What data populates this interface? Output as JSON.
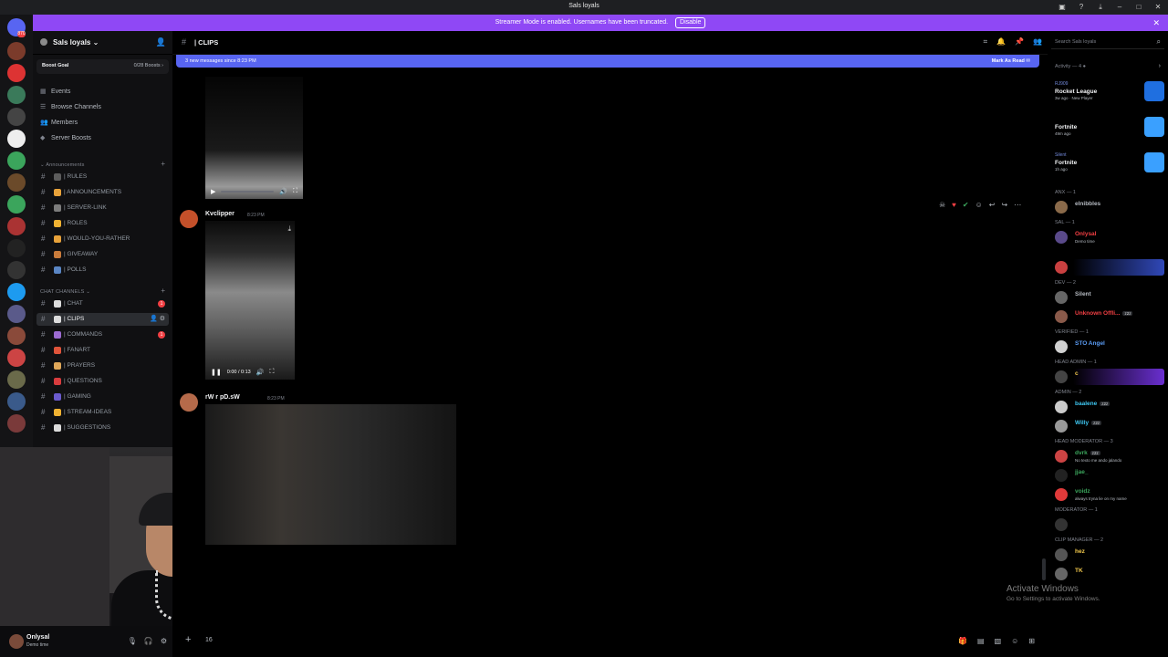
{
  "window": {
    "title": "Sals loyals"
  },
  "banner": {
    "text": "Streamer Mode is enabled. Usernames have been truncated.",
    "disable_label": "Disable"
  },
  "server": {
    "name": "Sals loyals",
    "boost_goal_label": "Boost Goal",
    "boost_count": "0/28 Boosts"
  },
  "nav": [
    {
      "label": "Events",
      "icon": "calendar-icon"
    },
    {
      "label": "Browse Channels",
      "icon": "browse-icon"
    },
    {
      "label": "Members",
      "icon": "members-icon"
    },
    {
      "label": "Server Boosts",
      "icon": "boost-icon"
    }
  ],
  "categories": {
    "announcements": "Announcements",
    "chat_channels": "CHAT CHANNELS"
  },
  "announcement_channels": [
    {
      "name": "| RULES",
      "emoji_color": "#5c5c5c"
    },
    {
      "name": "| ANNOUNCEMENTS",
      "emoji_color": "#e8a23a"
    },
    {
      "name": "| SERVER-LINK",
      "emoji_color": "#7c7c7c"
    },
    {
      "name": "| ROLES",
      "emoji_color": "#f0b232"
    },
    {
      "name": "| WOULD-YOU-RATHER",
      "emoji_color": "#e8a23a"
    },
    {
      "name": "| GIVEAWAY",
      "emoji_color": "#c97b3b"
    },
    {
      "name": "| POLLS",
      "emoji_color": "#5a86c5"
    }
  ],
  "chat_channels": [
    {
      "name": "| CHAT",
      "emoji_color": "#dcdcdc",
      "unread": "1"
    },
    {
      "name": "| CLIPS",
      "emoji_color": "#dcdcdc",
      "active": true
    },
    {
      "name": "| COMMANDS",
      "emoji_color": "#9c6bd1",
      "unread": "1"
    },
    {
      "name": "| FANART",
      "emoji_color": "#e0543a"
    },
    {
      "name": "| PRAYERS",
      "emoji_color": "#e0a85a"
    },
    {
      "name": "| QUESTIONS",
      "emoji_color": "#d83c3e"
    },
    {
      "name": "| GAMING",
      "emoji_color": "#6a5acd"
    },
    {
      "name": "| STREAM-IDEAS",
      "emoji_color": "#f0b232"
    },
    {
      "name": "| SUGGESTIONS",
      "emoji_color": "#dcdcdc"
    }
  ],
  "chat": {
    "channel_name": "| CLIPS",
    "new_messages": "3 new messages since 8:23 PM",
    "mark_as_read": "Mark As Read",
    "messages": [
      {
        "author": "Kvclipper",
        "time": "8:23 PM",
        "video_time": "0:00 / 0:13"
      },
      {
        "author": "rW r pD.sW",
        "time": "8:23 PM"
      }
    ]
  },
  "composer": {
    "count": "16"
  },
  "user": {
    "name": "Onlysal",
    "status": "Demo time"
  },
  "right": {
    "search_placeholder": "Search Sals loyals",
    "activity_label": "Activity — 4",
    "activities": [
      {
        "who": "RJ909",
        "game": "Rocket League",
        "when": "3w ago · New Player",
        "color": "#1f6fe0"
      },
      {
        "who": "",
        "game": "Fortnite",
        "when": "49m ago",
        "color": "#3aa0ff"
      },
      {
        "who": "Silent",
        "game": "Fortnite",
        "when": "1h ago",
        "color": "#3aa0ff"
      }
    ],
    "sections": [
      {
        "label": "ANX — 1",
        "members": [
          {
            "name": "elnibbles",
            "color": "#b5bac1",
            "status": "",
            "avatar": "#8a6a4a"
          }
        ]
      },
      {
        "label": "SAL — 1",
        "members": [
          {
            "name": "Onlysal",
            "color": "#f23f43",
            "status": "Demo time",
            "avatar": "#5a4a8a"
          }
        ]
      },
      {
        "label": "",
        "members": [
          {
            "name": "",
            "color": "#f23f43",
            "status": "",
            "avatar": "#c94040",
            "glow": "#3048b8"
          }
        ]
      },
      {
        "label": "DEV — 2",
        "members": [
          {
            "name": "Silent",
            "color": "#b5bac1",
            "status": "",
            "avatar": "#666"
          },
          {
            "name": "Unknown Offli...",
            "color": "#f23f43",
            "status": "",
            "avatar": "#8a5a4a",
            "tag": "z2z"
          }
        ]
      },
      {
        "label": "VERIFIED — 1",
        "members": [
          {
            "name": "STO Angel",
            "color": "#5a9cf5",
            "status": "",
            "avatar": "#d0d0d0"
          }
        ]
      },
      {
        "label": "HEAD ADMIN — 1",
        "members": [
          {
            "name": "c",
            "color": "#f2c94c",
            "status": "",
            "avatar": "#444",
            "glow": "#6a2fd0"
          }
        ]
      },
      {
        "label": "ADMIN — 2",
        "members": [
          {
            "name": "baalene",
            "color": "#3ec6f0",
            "status": "",
            "avatar": "#cccccc",
            "tag": "z2z"
          },
          {
            "name": "Willy",
            "color": "#3ec6f0",
            "status": "",
            "avatar": "#999",
            "tag": "z2z"
          }
        ]
      },
      {
        "label": "HEAD MODERATOR — 3",
        "members": [
          {
            "name": "dvrk",
            "color": "#3ba55c",
            "status": "No texto me ando jalando",
            "avatar": "#c44",
            "tag": "z2z"
          },
          {
            "name": "jjae_",
            "color": "#3ba55c",
            "status": "",
            "avatar": "#222"
          },
          {
            "name": "voidz",
            "color": "#3ba55c",
            "status": "always tryna lie on my name",
            "avatar": "#e03a3a"
          }
        ]
      },
      {
        "label": "MODERATOR — 1",
        "members": [
          {
            "name": "",
            "color": "#f23f43",
            "status": "",
            "avatar": "#333"
          }
        ]
      },
      {
        "label": "CLIP MANAGER — 2",
        "members": [
          {
            "name": "hez",
            "color": "#f2c94c",
            "status": "",
            "avatar": "#555"
          },
          {
            "name": "TK",
            "color": "#f2c94c",
            "status": "",
            "avatar": "#666"
          }
        ]
      }
    ]
  },
  "watermark": {
    "line1": "Activate Windows",
    "line2": "Go to Settings to activate Windows."
  }
}
